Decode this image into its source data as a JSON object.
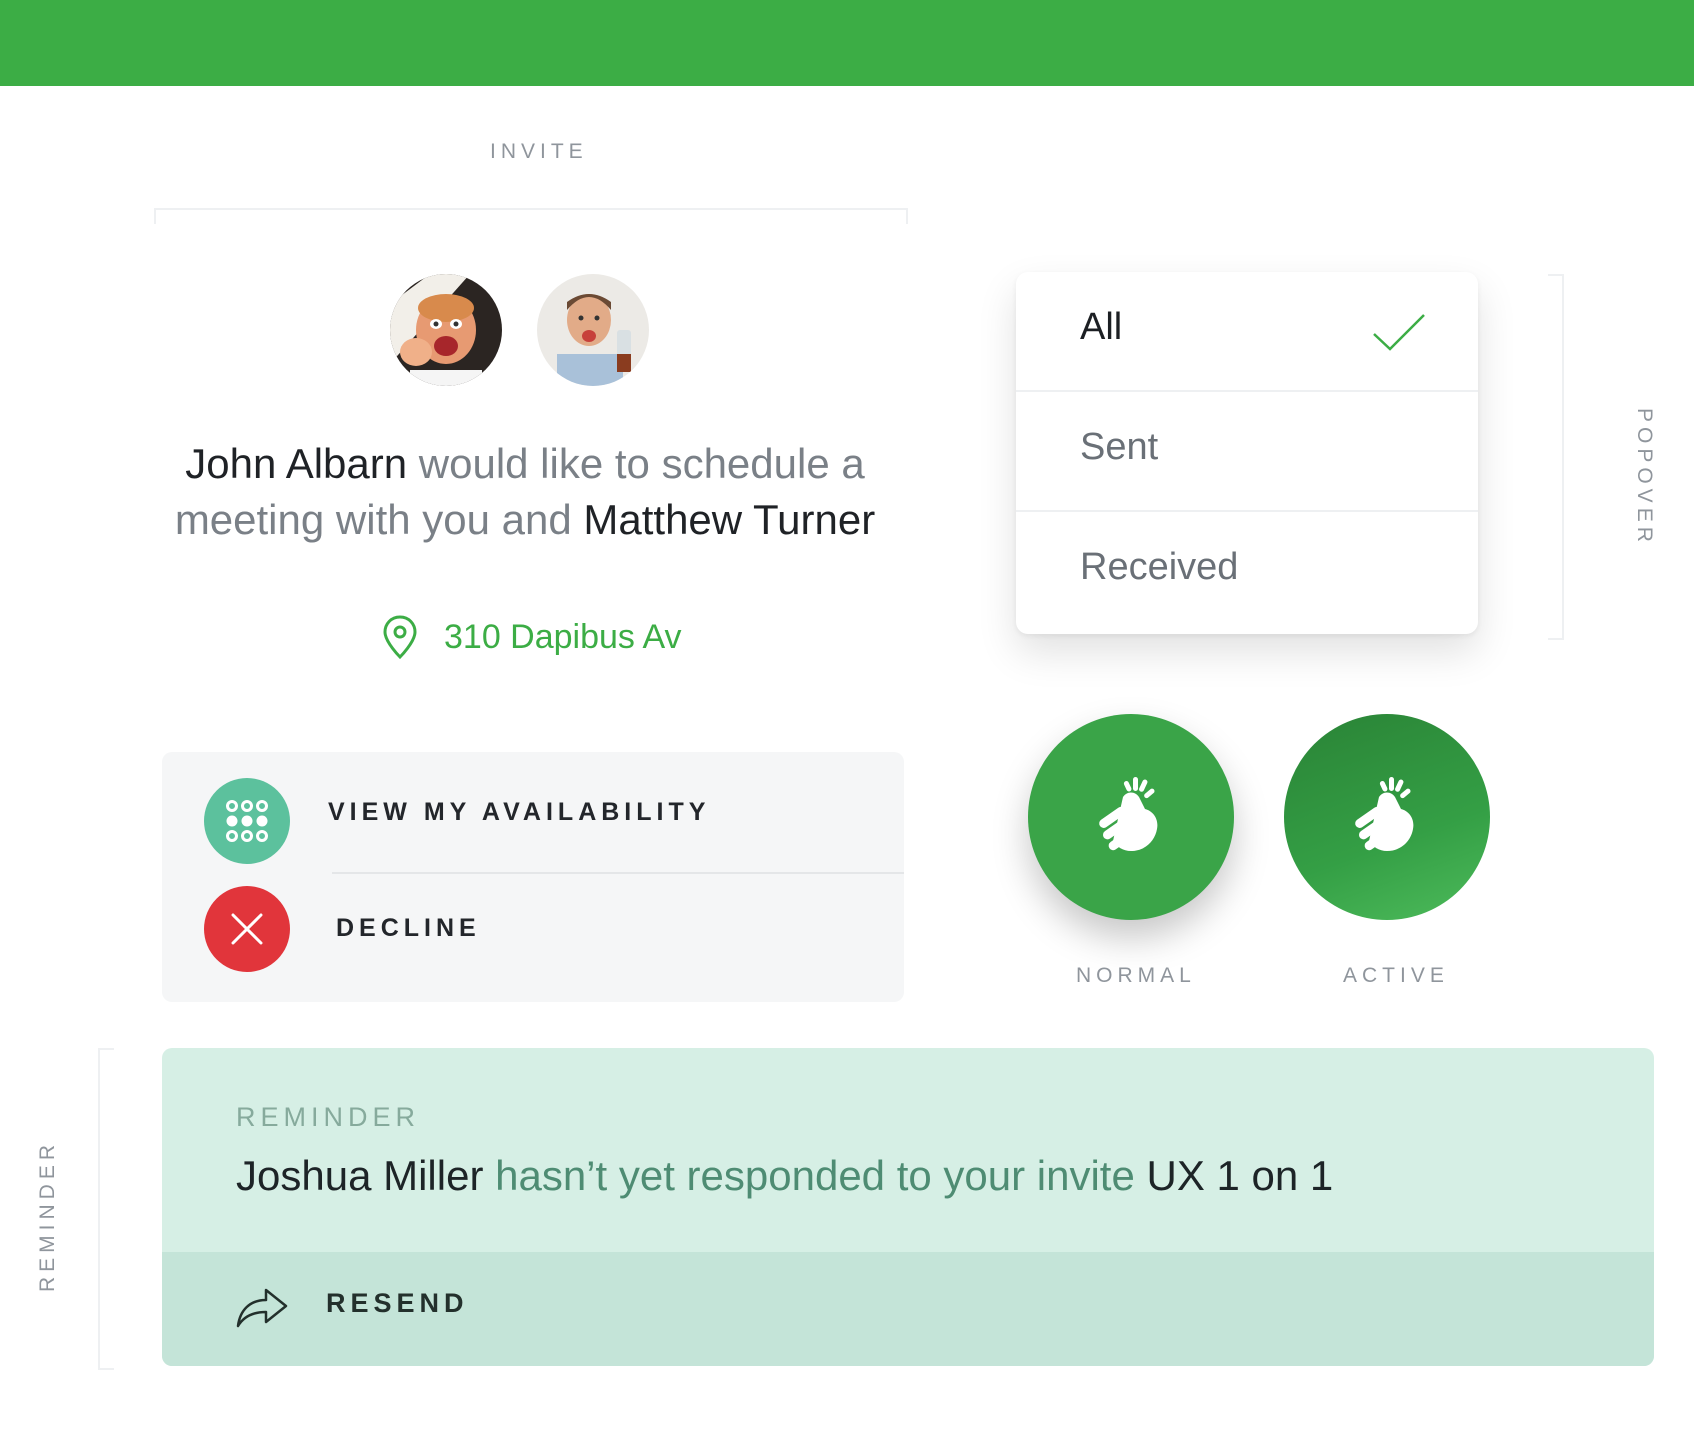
{
  "colors": {
    "brand_green": "#3cad45",
    "availability_teal": "#5cc19d",
    "decline_red": "#e1353b",
    "reminder_bg": "#d6efe5",
    "reminder_footer_bg": "#c4e4d8"
  },
  "labels": {
    "invite": "INVITE",
    "popover": "POPOVER",
    "reminder": "REMINDER"
  },
  "invite": {
    "inviter": "John Albarn",
    "message_part1": " would like to schedule a meeting with you and ",
    "invitee": "Matthew Turner",
    "location": "310 Dapibus Av",
    "location_icon": "map-pin-icon",
    "actions": {
      "availability_label": "VIEW MY AVAILABILITY",
      "availability_icon": "grid-dots-icon",
      "decline_label": "DECLINE",
      "decline_icon": "close-icon"
    }
  },
  "popover": {
    "items": [
      {
        "label": "All",
        "selected": true
      },
      {
        "label": "Sent",
        "selected": false
      },
      {
        "label": "Received",
        "selected": false
      }
    ],
    "check_icon": "checkmark-icon"
  },
  "fab": {
    "icon": "finger-snap-icon",
    "normal_label": "NORMAL",
    "active_label": "ACTIVE"
  },
  "reminder": {
    "title": "REMINDER",
    "person": "Joshua Miller",
    "message": " hasn’t yet responded to your invite ",
    "event": "UX 1 on 1",
    "action_label": "RESEND",
    "action_icon": "share-arrow-icon"
  }
}
